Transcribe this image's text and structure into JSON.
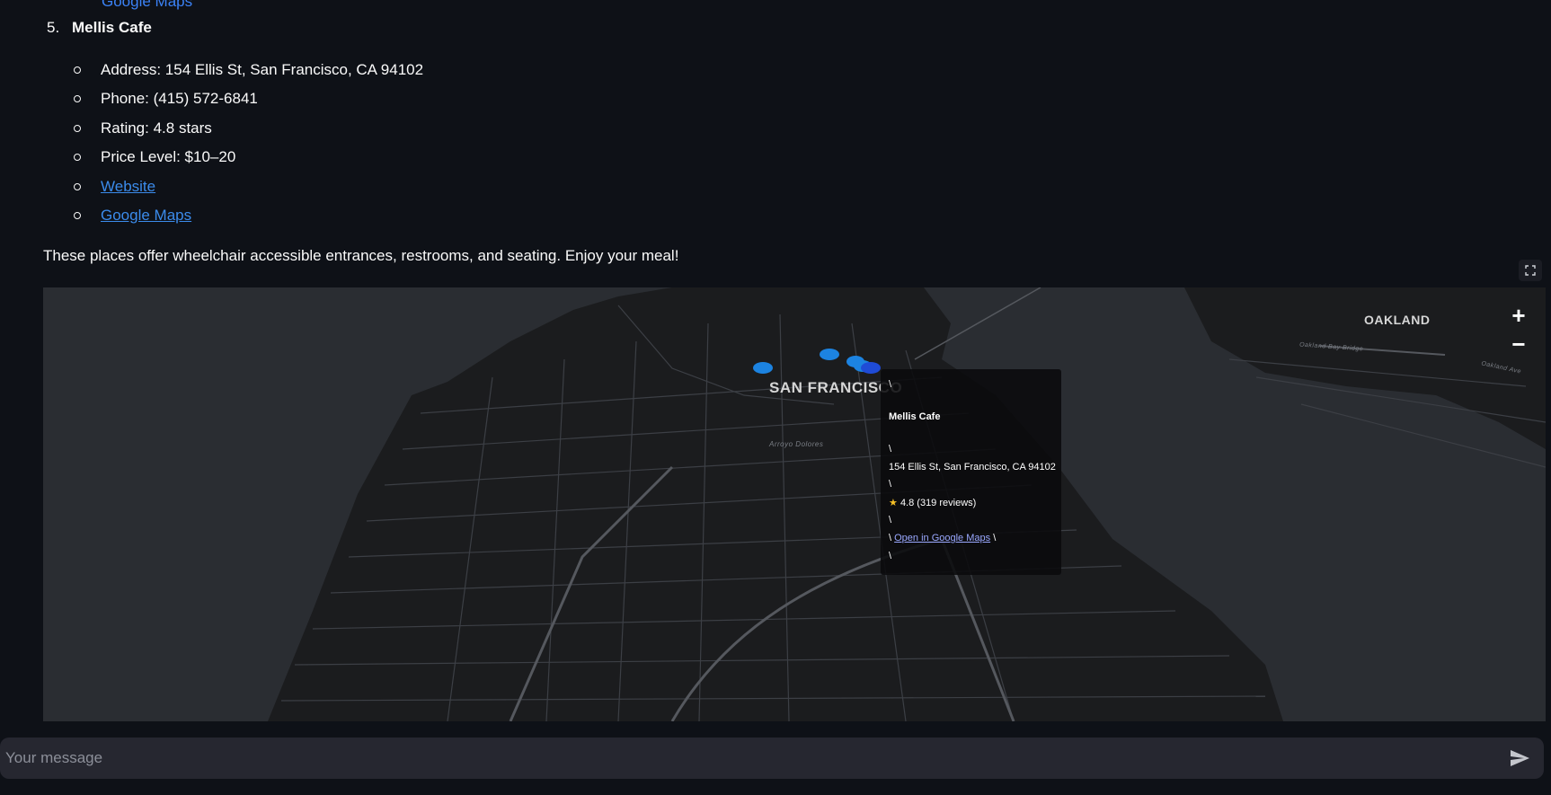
{
  "previous_item": {
    "cut_link": "Google Maps"
  },
  "restaurant": {
    "number": "5.",
    "name": "Mellis Cafe",
    "details": [
      {
        "text": "Address: 154 Ellis St, San Francisco, CA 94102"
      },
      {
        "text": "Phone: (415) 572-6841"
      },
      {
        "text": "Rating: 4.8 stars"
      },
      {
        "text": "Price Level: $10–20"
      }
    ],
    "links": {
      "website": "Website",
      "maps": "Google Maps"
    }
  },
  "closing_text": "These places offer wheelchair accessible entrances, restrooms, and seating. Enjoy your meal!",
  "map": {
    "labels": {
      "city": "SAN FRANCISCO",
      "oakland": "OAKLAND",
      "street1": "Arroyo Dolores",
      "street2": "Oakland Bay Bridge",
      "street3": "Oakland Ave"
    },
    "zoom_in": "+",
    "zoom_out": "−",
    "tooltip": {
      "sep": "\\",
      "name": "Mellis Cafe",
      "address": "154 Ellis St, San Francisco, CA 94102",
      "rating": "4.8 (319 reviews)",
      "link_text": "Open in Google Maps"
    },
    "colors": {
      "marker": "#1c83e1",
      "marker_active": "#1f4bd6"
    }
  },
  "chat": {
    "placeholder": "Your message"
  }
}
